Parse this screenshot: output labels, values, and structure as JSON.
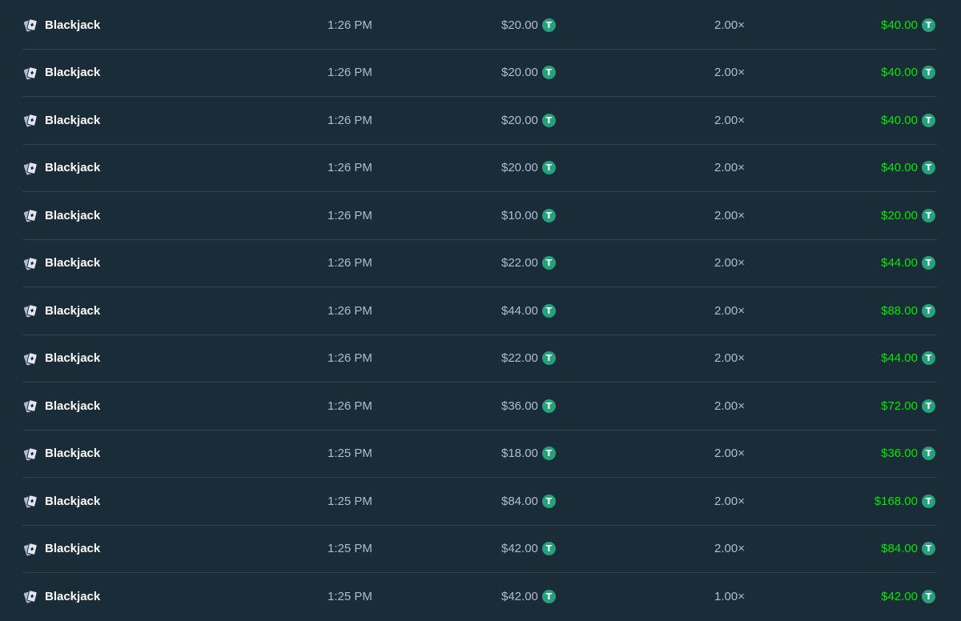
{
  "currency_icon": "tether-usdt-icon",
  "colors": {
    "background": "#1a2c38",
    "divider": "#2f4553",
    "muted_text": "#b1bad3",
    "payout_green": "#00e701",
    "coin_green": "#26a17b"
  },
  "bets": [
    {
      "game": "Blackjack",
      "game_icon": "cards-icon",
      "time": "1:26 PM",
      "bet_amount": "$20.00",
      "multiplier": "2.00×",
      "payout": "$40.00"
    },
    {
      "game": "Blackjack",
      "game_icon": "cards-icon",
      "time": "1:26 PM",
      "bet_amount": "$20.00",
      "multiplier": "2.00×",
      "payout": "$40.00"
    },
    {
      "game": "Blackjack",
      "game_icon": "cards-icon",
      "time": "1:26 PM",
      "bet_amount": "$20.00",
      "multiplier": "2.00×",
      "payout": "$40.00"
    },
    {
      "game": "Blackjack",
      "game_icon": "cards-icon",
      "time": "1:26 PM",
      "bet_amount": "$20.00",
      "multiplier": "2.00×",
      "payout": "$40.00"
    },
    {
      "game": "Blackjack",
      "game_icon": "cards-icon",
      "time": "1:26 PM",
      "bet_amount": "$10.00",
      "multiplier": "2.00×",
      "payout": "$20.00"
    },
    {
      "game": "Blackjack",
      "game_icon": "cards-icon",
      "time": "1:26 PM",
      "bet_amount": "$22.00",
      "multiplier": "2.00×",
      "payout": "$44.00"
    },
    {
      "game": "Blackjack",
      "game_icon": "cards-icon",
      "time": "1:26 PM",
      "bet_amount": "$44.00",
      "multiplier": "2.00×",
      "payout": "$88.00"
    },
    {
      "game": "Blackjack",
      "game_icon": "cards-icon",
      "time": "1:26 PM",
      "bet_amount": "$22.00",
      "multiplier": "2.00×",
      "payout": "$44.00"
    },
    {
      "game": "Blackjack",
      "game_icon": "cards-icon",
      "time": "1:26 PM",
      "bet_amount": "$36.00",
      "multiplier": "2.00×",
      "payout": "$72.00"
    },
    {
      "game": "Blackjack",
      "game_icon": "cards-icon",
      "time": "1:25 PM",
      "bet_amount": "$18.00",
      "multiplier": "2.00×",
      "payout": "$36.00"
    },
    {
      "game": "Blackjack",
      "game_icon": "cards-icon",
      "time": "1:25 PM",
      "bet_amount": "$84.00",
      "multiplier": "2.00×",
      "payout": "$168.00"
    },
    {
      "game": "Blackjack",
      "game_icon": "cards-icon",
      "time": "1:25 PM",
      "bet_amount": "$42.00",
      "multiplier": "2.00×",
      "payout": "$84.00"
    },
    {
      "game": "Blackjack",
      "game_icon": "cards-icon",
      "time": "1:25 PM",
      "bet_amount": "$42.00",
      "multiplier": "1.00×",
      "payout": "$42.00"
    }
  ]
}
